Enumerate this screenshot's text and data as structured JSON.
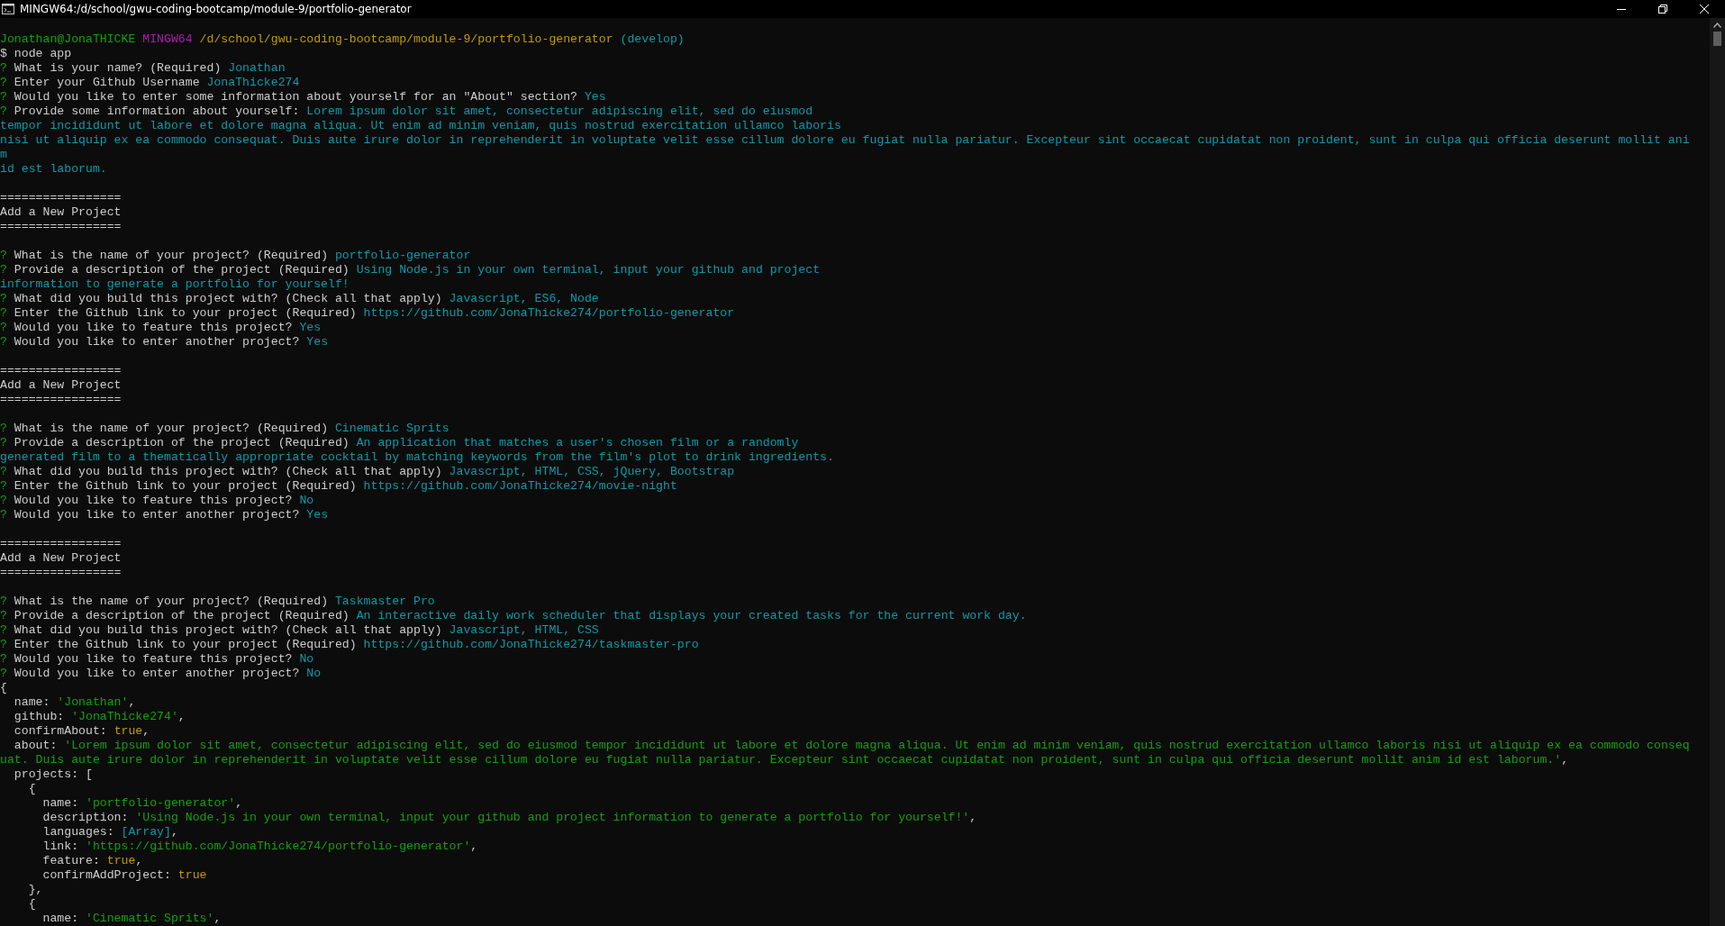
{
  "window": {
    "title": "MINGW64:/d/school/gwu-coding-bootcamp/module-9/portfolio-generator"
  },
  "terminal": {
    "lines": [
      {
        "kind": "blank"
      },
      {
        "kind": "text",
        "segments": [
          {
            "kind": "user",
            "text": "Jonathan@JonaTHICKE"
          },
          {
            "kind": "host",
            "text": " MINGW64"
          },
          {
            "kind": "path",
            "text": " /d/school/gwu-coding-bootcamp/module-9/portfolio-generator"
          },
          {
            "kind": "branch",
            "text": " (develop)"
          }
        ]
      },
      {
        "kind": "text",
        "segments": [
          {
            "kind": "plain",
            "text": "$ node app"
          }
        ]
      },
      {
        "kind": "text",
        "segments": [
          {
            "kind": "q",
            "text": "?"
          },
          {
            "kind": "ask",
            "text": " What is your name? (Required)"
          },
          {
            "kind": "ans",
            "text": " Jonathan"
          }
        ]
      },
      {
        "kind": "text",
        "segments": [
          {
            "kind": "q",
            "text": "?"
          },
          {
            "kind": "ask",
            "text": " Enter your Github Username"
          },
          {
            "kind": "ans",
            "text": " JonaThicke274"
          }
        ]
      },
      {
        "kind": "text",
        "segments": [
          {
            "kind": "q",
            "text": "?"
          },
          {
            "kind": "ask",
            "text": " Would you like to enter some information about yourself for an \"About\" section?"
          },
          {
            "kind": "ans",
            "text": " Yes"
          }
        ]
      },
      {
        "kind": "text",
        "segments": [
          {
            "kind": "q",
            "text": "?"
          },
          {
            "kind": "ask",
            "text": " Provide some information about yourself:"
          },
          {
            "kind": "ans",
            "text": " Lorem ipsum dolor sit amet, consectetur adipiscing elit, sed do eiusmod"
          }
        ]
      },
      {
        "kind": "text",
        "segments": [
          {
            "kind": "ans",
            "text": "tempor incididunt ut labore et dolore magna aliqua. Ut enim ad minim veniam, quis nostrud exercitation ullamco laboris"
          }
        ]
      },
      {
        "kind": "text",
        "segments": [
          {
            "kind": "ans",
            "text": "nisi ut aliquip ex ea commodo consequat. Duis aute irure dolor in reprehenderit in voluptate velit esse cillum dolore eu fugiat nulla pariatur. Excepteur sint occaecat cupidatat non proident, sunt in culpa qui officia deserunt mollit ani"
          }
        ]
      },
      {
        "kind": "text",
        "segments": [
          {
            "kind": "ans",
            "text": "m"
          }
        ]
      },
      {
        "kind": "text",
        "segments": [
          {
            "kind": "ans",
            "text": "id est laborum."
          }
        ]
      },
      {
        "kind": "blank"
      },
      {
        "kind": "text",
        "segments": [
          {
            "kind": "plain",
            "text": "================="
          }
        ]
      },
      {
        "kind": "text",
        "segments": [
          {
            "kind": "plain",
            "text": "Add a New Project"
          }
        ]
      },
      {
        "kind": "text",
        "segments": [
          {
            "kind": "plain",
            "text": "================="
          }
        ]
      },
      {
        "kind": "blank"
      },
      {
        "kind": "text",
        "segments": [
          {
            "kind": "q",
            "text": "?"
          },
          {
            "kind": "ask",
            "text": " What is the name of your project? (Required)"
          },
          {
            "kind": "ans",
            "text": " portfolio-generator"
          }
        ]
      },
      {
        "kind": "text",
        "segments": [
          {
            "kind": "q",
            "text": "?"
          },
          {
            "kind": "ask",
            "text": " Provide a description of the project (Required)"
          },
          {
            "kind": "ans",
            "text": " Using Node.js in your own terminal, input your github and project"
          }
        ]
      },
      {
        "kind": "text",
        "segments": [
          {
            "kind": "ans",
            "text": "information to generate a portfolio for yourself!"
          }
        ]
      },
      {
        "kind": "text",
        "segments": [
          {
            "kind": "q",
            "text": "?"
          },
          {
            "kind": "ask",
            "text": " What did you build this project with? (Check all that apply)"
          },
          {
            "kind": "ans",
            "text": " Javascript, ES6, Node"
          }
        ]
      },
      {
        "kind": "text",
        "segments": [
          {
            "kind": "q",
            "text": "?"
          },
          {
            "kind": "ask",
            "text": " Enter the Github link to your project (Required)"
          },
          {
            "kind": "ans",
            "text": " https://github.com/JonaThicke274/portfolio-generator"
          }
        ]
      },
      {
        "kind": "text",
        "segments": [
          {
            "kind": "q",
            "text": "?"
          },
          {
            "kind": "ask",
            "text": " Would you like to feature this project?"
          },
          {
            "kind": "ans",
            "text": " Yes"
          }
        ]
      },
      {
        "kind": "text",
        "segments": [
          {
            "kind": "q",
            "text": "?"
          },
          {
            "kind": "ask",
            "text": " Would you like to enter another project?"
          },
          {
            "kind": "ans",
            "text": " Yes"
          }
        ]
      },
      {
        "kind": "blank"
      },
      {
        "kind": "text",
        "segments": [
          {
            "kind": "plain",
            "text": "================="
          }
        ]
      },
      {
        "kind": "text",
        "segments": [
          {
            "kind": "plain",
            "text": "Add a New Project"
          }
        ]
      },
      {
        "kind": "text",
        "segments": [
          {
            "kind": "plain",
            "text": "================="
          }
        ]
      },
      {
        "kind": "blank"
      },
      {
        "kind": "text",
        "segments": [
          {
            "kind": "q",
            "text": "?"
          },
          {
            "kind": "ask",
            "text": " What is the name of your project? (Required)"
          },
          {
            "kind": "ans",
            "text": " Cinematic Sprits"
          }
        ]
      },
      {
        "kind": "text",
        "segments": [
          {
            "kind": "q",
            "text": "?"
          },
          {
            "kind": "ask",
            "text": " Provide a description of the project (Required)"
          },
          {
            "kind": "ans",
            "text": " An application that matches a user's chosen film or a randomly"
          }
        ]
      },
      {
        "kind": "text",
        "segments": [
          {
            "kind": "ans",
            "text": "generated film to a thematically appropriate cocktail by matching keywords from the film's plot to drink ingredients."
          }
        ]
      },
      {
        "kind": "text",
        "segments": [
          {
            "kind": "q",
            "text": "?"
          },
          {
            "kind": "ask",
            "text": " What did you build this project with? (Check all that apply)"
          },
          {
            "kind": "ans",
            "text": " Javascript, HTML, CSS, jQuery, Bootstrap"
          }
        ]
      },
      {
        "kind": "text",
        "segments": [
          {
            "kind": "q",
            "text": "?"
          },
          {
            "kind": "ask",
            "text": " Enter the Github link to your project (Required)"
          },
          {
            "kind": "ans",
            "text": " https://github.com/JonaThicke274/movie-night"
          }
        ]
      },
      {
        "kind": "text",
        "segments": [
          {
            "kind": "q",
            "text": "?"
          },
          {
            "kind": "ask",
            "text": " Would you like to feature this project?"
          },
          {
            "kind": "ans",
            "text": " No"
          }
        ]
      },
      {
        "kind": "text",
        "segments": [
          {
            "kind": "q",
            "text": "?"
          },
          {
            "kind": "ask",
            "text": " Would you like to enter another project?"
          },
          {
            "kind": "ans",
            "text": " Yes"
          }
        ]
      },
      {
        "kind": "blank"
      },
      {
        "kind": "text",
        "segments": [
          {
            "kind": "plain",
            "text": "================="
          }
        ]
      },
      {
        "kind": "text",
        "segments": [
          {
            "kind": "plain",
            "text": "Add a New Project"
          }
        ]
      },
      {
        "kind": "text",
        "segments": [
          {
            "kind": "plain",
            "text": "================="
          }
        ]
      },
      {
        "kind": "blank"
      },
      {
        "kind": "text",
        "segments": [
          {
            "kind": "q",
            "text": "?"
          },
          {
            "kind": "ask",
            "text": " What is the name of your project? (Required)"
          },
          {
            "kind": "ans",
            "text": " Taskmaster Pro"
          }
        ]
      },
      {
        "kind": "text",
        "segments": [
          {
            "kind": "q",
            "text": "?"
          },
          {
            "kind": "ask",
            "text": " Provide a description of the project (Required)"
          },
          {
            "kind": "ans",
            "text": " An interactive daily work scheduler that displays your created tasks for the current work day."
          }
        ]
      },
      {
        "kind": "text",
        "segments": [
          {
            "kind": "q",
            "text": "?"
          },
          {
            "kind": "ask",
            "text": " What did you build this project with? (Check all that apply)"
          },
          {
            "kind": "ans",
            "text": " Javascript, HTML, CSS"
          }
        ]
      },
      {
        "kind": "text",
        "segments": [
          {
            "kind": "q",
            "text": "?"
          },
          {
            "kind": "ask",
            "text": " Enter the Github link to your project (Required)"
          },
          {
            "kind": "ans",
            "text": " https://github.com/JonaThicke274/taskmaster-pro"
          }
        ]
      },
      {
        "kind": "text",
        "segments": [
          {
            "kind": "q",
            "text": "?"
          },
          {
            "kind": "ask",
            "text": " Would you like to feature this project?"
          },
          {
            "kind": "ans",
            "text": " No"
          }
        ]
      },
      {
        "kind": "text",
        "segments": [
          {
            "kind": "q",
            "text": "?"
          },
          {
            "kind": "ask",
            "text": " Would you like to enter another project?"
          },
          {
            "kind": "ans",
            "text": " No"
          }
        ]
      },
      {
        "kind": "text",
        "segments": [
          {
            "kind": "punct",
            "text": "{"
          }
        ]
      },
      {
        "kind": "text",
        "segments": [
          {
            "kind": "key",
            "text": "  name: "
          },
          {
            "kind": "str",
            "text": "'Jonathan'"
          },
          {
            "kind": "punct",
            "text": ","
          }
        ]
      },
      {
        "kind": "text",
        "segments": [
          {
            "kind": "key",
            "text": "  github: "
          },
          {
            "kind": "str",
            "text": "'JonaThicke274'"
          },
          {
            "kind": "punct",
            "text": ","
          }
        ]
      },
      {
        "kind": "text",
        "segments": [
          {
            "kind": "key",
            "text": "  confirmAbout: "
          },
          {
            "kind": "bool",
            "text": "true"
          },
          {
            "kind": "punct",
            "text": ","
          }
        ]
      },
      {
        "kind": "text",
        "segments": [
          {
            "kind": "key",
            "text": "  about: "
          },
          {
            "kind": "str",
            "text": "'Lorem ipsum dolor sit amet, consectetur adipiscing elit, sed do eiusmod tempor incididunt ut labore et dolore magna aliqua. Ut enim ad minim veniam, quis nostrud exercitation ullamco laboris nisi ut aliquip ex ea commodo conseq"
          }
        ]
      },
      {
        "kind": "text",
        "segments": [
          {
            "kind": "str",
            "text": "uat. Duis aute irure dolor in reprehenderit in voluptate velit esse cillum dolore eu fugiat nulla pariatur. Excepteur sint occaecat cupidatat non proident, sunt in culpa qui officia deserunt mollit anim id est laborum.'"
          },
          {
            "kind": "punct",
            "text": ","
          }
        ]
      },
      {
        "kind": "text",
        "segments": [
          {
            "kind": "key",
            "text": "  projects: ["
          }
        ]
      },
      {
        "kind": "text",
        "segments": [
          {
            "kind": "punct",
            "text": "    {"
          }
        ]
      },
      {
        "kind": "text",
        "segments": [
          {
            "kind": "key",
            "text": "      name: "
          },
          {
            "kind": "str",
            "text": "'portfolio-generator'"
          },
          {
            "kind": "punct",
            "text": ","
          }
        ]
      },
      {
        "kind": "text",
        "segments": [
          {
            "kind": "key",
            "text": "      description: "
          },
          {
            "kind": "str",
            "text": "'Using Node.js in your own terminal, input your github and project information to generate a portfolio for yourself!'"
          },
          {
            "kind": "punct",
            "text": ","
          }
        ]
      },
      {
        "kind": "text",
        "segments": [
          {
            "kind": "key",
            "text": "      languages: "
          },
          {
            "kind": "ref",
            "text": "[Array]"
          },
          {
            "kind": "punct",
            "text": ","
          }
        ]
      },
      {
        "kind": "text",
        "segments": [
          {
            "kind": "key",
            "text": "      link: "
          },
          {
            "kind": "str",
            "text": "'https://github.com/JonaThicke274/portfolio-generator'"
          },
          {
            "kind": "punct",
            "text": ","
          }
        ]
      },
      {
        "kind": "text",
        "segments": [
          {
            "kind": "key",
            "text": "      feature: "
          },
          {
            "kind": "bool",
            "text": "true"
          },
          {
            "kind": "punct",
            "text": ","
          }
        ]
      },
      {
        "kind": "text",
        "segments": [
          {
            "kind": "key",
            "text": "      confirmAddProject: "
          },
          {
            "kind": "bool",
            "text": "true"
          }
        ]
      },
      {
        "kind": "text",
        "segments": [
          {
            "kind": "punct",
            "text": "    },"
          }
        ]
      },
      {
        "kind": "text",
        "segments": [
          {
            "kind": "punct",
            "text": "    {"
          }
        ]
      },
      {
        "kind": "text",
        "segments": [
          {
            "kind": "key",
            "text": "      name: "
          },
          {
            "kind": "str",
            "text": "'Cinematic Sprits'"
          },
          {
            "kind": "punct",
            "text": ","
          }
        ]
      }
    ]
  }
}
